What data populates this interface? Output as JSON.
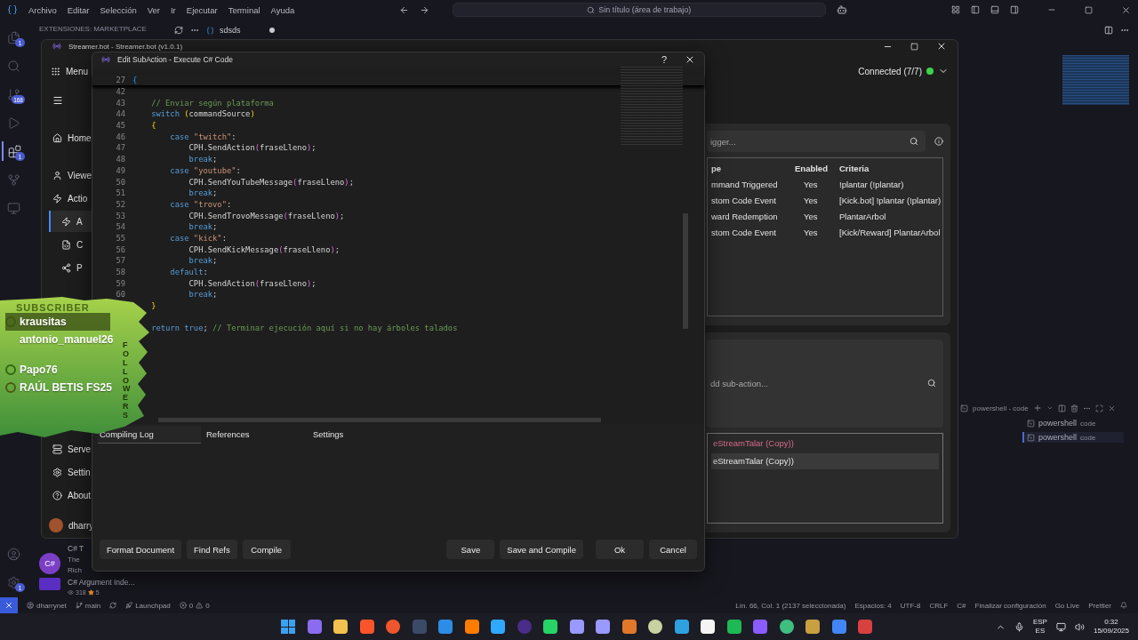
{
  "vscode": {
    "menu": [
      "Archivo",
      "Editar",
      "Selección",
      "Ver",
      "Ir",
      "Ejecutar",
      "Terminal",
      "Ayuda"
    ],
    "search": {
      "value": "Sin título (área de trabajo)"
    },
    "activity": [
      {
        "kind": "files",
        "badge": "1"
      },
      {
        "kind": "search"
      },
      {
        "kind": "source-control",
        "badge": "168"
      },
      {
        "kind": "run"
      },
      {
        "kind": "extensions",
        "badge": "1",
        "selected": true
      },
      {
        "kind": "branch"
      },
      {
        "kind": "remote"
      }
    ],
    "activity_bottom": [
      {
        "kind": "account"
      },
      {
        "kind": "settings",
        "badge": "1"
      }
    ],
    "side_panel": {
      "title": "EXTENSIONES: MARKETPLACE",
      "extensions": [
        {
          "icon_text": "C#",
          "name": "C# T",
          "line_2": "The",
          "line_3": "Rich"
        },
        {
          "name": "C# Argument Inde...",
          "downloads": "318",
          "rating": "5"
        }
      ]
    },
    "editor_tab": {
      "label": "sdsds",
      "modified": true
    },
    "terminal": {
      "title": "powershell - code",
      "sessions": [
        {
          "name": "powershell",
          "detail": "code",
          "selected": false
        },
        {
          "name": "powershell",
          "detail": "code",
          "selected": true
        }
      ]
    },
    "status_bar": {
      "account": "dharrynet",
      "branch": "main",
      "launchpad": "Launchpad",
      "errors": "0",
      "warnings": "0",
      "right": [
        "Lín. 66, Col. 1 (2137 seleccionada)",
        "Espacios: 4",
        "UTF-8",
        "CRLF",
        "C#",
        "Finalizar configuración",
        "Go Live",
        "Prettier"
      ]
    }
  },
  "streamerbot": {
    "title": "Streamer.bot - Streamer.bot (v1.0.1)",
    "menu": "Menu",
    "connection": {
      "label": "Connected (7/7)",
      "connected": true
    },
    "nav": [
      {
        "label": "Home",
        "kind": "home",
        "selected": false
      },
      {
        "label": "Viewe",
        "kind": "user",
        "selected": false
      },
      {
        "label": "Actio",
        "kind": "bolt",
        "selected": false,
        "children": [
          {
            "label": "A",
            "kind": "bolt",
            "selected": true
          },
          {
            "label": "C",
            "kind": "code",
            "selected": false
          },
          {
            "label": "P",
            "kind": "share",
            "selected": false
          }
        ]
      }
    ],
    "nav_bottom": [
      {
        "label": "Serve",
        "kind": "server",
        "selected": false
      },
      {
        "label": "Settin",
        "kind": "gear",
        "selected": false
      },
      {
        "label": "About",
        "kind": "help",
        "selected": false
      }
    ],
    "user": "dharry",
    "triggers": {
      "search_placeholder": "igger...",
      "columns": [
        "pe",
        "Enabled",
        "Criteria"
      ],
      "rows": [
        {
          "type": "mmand Triggered",
          "enabled": "Yes",
          "criteria": "!plantar (!plantar)"
        },
        {
          "type": "stom Code Event",
          "enabled": "Yes",
          "criteria": "[Kick.bot] !plantar (!plantar)"
        },
        {
          "type": "ward Redemption",
          "enabled": "Yes",
          "criteria": "PlantarArbol"
        },
        {
          "type": "stom Code Event",
          "enabled": "Yes",
          "criteria": "[Kick/Reward] PlantarArbol"
        }
      ]
    },
    "subactions": {
      "search_placeholder": "dd sub-action...",
      "items": [
        {
          "label": "eStreamTalar (Copy))",
          "enabled": false,
          "selected": false
        },
        {
          "label": "eStreamTalar (Copy))",
          "enabled": true,
          "selected": true
        }
      ]
    }
  },
  "dialog": {
    "title": "Edit SubAction - Execute C# Code",
    "help": "?",
    "lines": [
      {
        "n": "27",
        "seg": [
          {
            "kind": "bracket3",
            "text": "{"
          }
        ]
      },
      {
        "n": "42"
      },
      {
        "n": "43",
        "seg": [
          {
            "kind": "comment",
            "text": "    // Enviar según plataforma"
          }
        ]
      },
      {
        "n": "44",
        "seg": [
          {
            "kind": "keyword",
            "text": "    switch "
          },
          {
            "kind": "bracket",
            "text": "("
          },
          {
            "kind": "plain",
            "text": "commandSource"
          },
          {
            "kind": "bracket",
            "text": ")"
          }
        ]
      },
      {
        "n": "45",
        "seg": [
          {
            "kind": "bracket",
            "text": "    {"
          }
        ]
      },
      {
        "n": "46",
        "seg": [
          {
            "kind": "keyword",
            "text": "        case "
          },
          {
            "kind": "string",
            "text": "\"twitch\""
          },
          {
            "kind": "plain",
            "text": ":"
          }
        ]
      },
      {
        "n": "47",
        "seg": [
          {
            "kind": "plain",
            "text": "            CPH.SendAction"
          },
          {
            "kind": "bracket2",
            "text": "("
          },
          {
            "kind": "plain",
            "text": "fraseLleno"
          },
          {
            "kind": "bracket2",
            "text": ")"
          },
          {
            "kind": "plain",
            "text": ";"
          }
        ]
      },
      {
        "n": "48",
        "seg": [
          {
            "kind": "keyword",
            "text": "            break"
          },
          {
            "kind": "plain",
            "text": ";"
          }
        ]
      },
      {
        "n": "49",
        "seg": [
          {
            "kind": "keyword",
            "text": "        case "
          },
          {
            "kind": "string",
            "text": "\"youtube\""
          },
          {
            "kind": "plain",
            "text": ":"
          }
        ]
      },
      {
        "n": "50",
        "seg": [
          {
            "kind": "plain",
            "text": "            CPH.SendYouTubeMessage"
          },
          {
            "kind": "bracket2",
            "text": "("
          },
          {
            "kind": "plain",
            "text": "fraseLleno"
          },
          {
            "kind": "bracket2",
            "text": ")"
          },
          {
            "kind": "plain",
            "text": ";"
          }
        ]
      },
      {
        "n": "51",
        "seg": [
          {
            "kind": "keyword",
            "text": "            break"
          },
          {
            "kind": "plain",
            "text": ";"
          }
        ]
      },
      {
        "n": "52",
        "seg": [
          {
            "kind": "keyword",
            "text": "        case "
          },
          {
            "kind": "string",
            "text": "\"trovo\""
          },
          {
            "kind": "plain",
            "text": ":"
          }
        ]
      },
      {
        "n": "53",
        "seg": [
          {
            "kind": "plain",
            "text": "            CPH.SendTrovoMessage"
          },
          {
            "kind": "bracket2",
            "text": "("
          },
          {
            "kind": "plain",
            "text": "fraseLleno"
          },
          {
            "kind": "bracket2",
            "text": ")"
          },
          {
            "kind": "plain",
            "text": ";"
          }
        ]
      },
      {
        "n": "54",
        "seg": [
          {
            "kind": "keyword",
            "text": "            break"
          },
          {
            "kind": "plain",
            "text": ";"
          }
        ]
      },
      {
        "n": "55",
        "seg": [
          {
            "kind": "keyword",
            "text": "        case "
          },
          {
            "kind": "string",
            "text": "\"kick\""
          },
          {
            "kind": "plain",
            "text": ":"
          }
        ]
      },
      {
        "n": "56",
        "seg": [
          {
            "kind": "plain",
            "text": "            CPH.SendKickMessage"
          },
          {
            "kind": "bracket2",
            "text": "("
          },
          {
            "kind": "plain",
            "text": "fraseLleno"
          },
          {
            "kind": "bracket2",
            "text": ")"
          },
          {
            "kind": "plain",
            "text": ";"
          }
        ]
      },
      {
        "n": "57",
        "seg": [
          {
            "kind": "keyword",
            "text": "            break"
          },
          {
            "kind": "plain",
            "text": ";"
          }
        ]
      },
      {
        "n": "58",
        "seg": [
          {
            "kind": "keyword",
            "text": "        default"
          },
          {
            "kind": "plain",
            "text": ":"
          }
        ]
      },
      {
        "n": "59",
        "seg": [
          {
            "kind": "plain",
            "text": "            CPH.SendAction"
          },
          {
            "kind": "bracket2",
            "text": "("
          },
          {
            "kind": "plain",
            "text": "fraseLleno"
          },
          {
            "kind": "bracket2",
            "text": ")"
          },
          {
            "kind": "plain",
            "text": ";"
          }
        ]
      },
      {
        "n": "60",
        "seg": [
          {
            "kind": "keyword",
            "text": "            break"
          },
          {
            "kind": "plain",
            "text": ";"
          }
        ]
      },
      {
        "seg": [
          {
            "kind": "bracket",
            "text": "    }"
          }
        ]
      },
      {
        "space_before": true,
        "seg": [
          {
            "kind": "keyword",
            "text": "    return true"
          },
          {
            "kind": "plain",
            "text": "; "
          },
          {
            "kind": "comment",
            "text": "// Terminar ejecución aquí si no hay árboles talados"
          }
        ]
      }
    ],
    "tabs": [
      {
        "label": "Compiling Log",
        "selected": true
      },
      {
        "label": "References",
        "selected": false
      },
      {
        "label": "Settings",
        "selected": false
      }
    ],
    "left_buttons": [
      "Format Document",
      "Find Refs",
      "Compile"
    ],
    "right_buttons": [
      "Save",
      "Save and Compile",
      "Ok",
      "Cancel"
    ]
  },
  "overlay": {
    "subscriber_heading": "SUBSCRIBER",
    "subscriber": {
      "name": "krausitas",
      "kind": "twitch"
    },
    "followers_heading": "FOLLOWERS",
    "followers": [
      {
        "name": "antonio_manuel26"
      },
      {
        "name": "Papo76",
        "kind": "kick"
      },
      {
        "name": "RAÚL BETIS FS25",
        "kind": "youtube"
      }
    ]
  },
  "taskbar": {
    "language": "ESP",
    "layout": "ES",
    "time": "0:32",
    "date": "15/09/2025"
  }
}
